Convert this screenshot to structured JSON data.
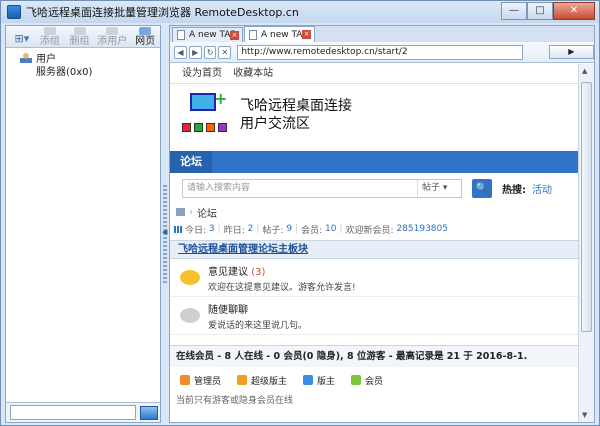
{
  "window": {
    "title": "飞哈远程桌面连接批量管理浏览器 RemoteDesktop.cn",
    "minimize": "—",
    "maximize": "□",
    "close": "✕"
  },
  "left_toolbar": {
    "items": [
      "添组",
      "删组",
      "添用户",
      "网页"
    ]
  },
  "tree": {
    "items": [
      "用户",
      "服务器(0x0)"
    ]
  },
  "tabs": [
    {
      "label": "A new TAB",
      "close": "×"
    },
    {
      "label": "A new TAB",
      "close": "×"
    }
  ],
  "address": {
    "url": "http://www.remotedesktop.cn/start/2",
    "go": "▶"
  },
  "site": {
    "top_links": [
      "设为首页",
      "收藏本站"
    ],
    "logo_line1": "飞哈远程桌面连接",
    "logo_line2": "用户交流区",
    "nav_item": "论坛",
    "search_placeholder": "请输入搜索内容",
    "search_scope": "帖子 ▾",
    "search_button": "🔍",
    "hot_label": "热搜:",
    "hot_link": "活动",
    "breadcrumb": "论坛",
    "stats": {
      "today_label": "今日:",
      "today": "3",
      "yesterday_label": "昨日:",
      "yesterday": "2",
      "posts_label": "帖子:",
      "posts": "9",
      "members_label": "会员:",
      "members": "10",
      "newest_label": "欢迎新会员:",
      "newest": "285193805"
    },
    "section_title": "飞哈远程桌面管理论坛主板块",
    "forums": [
      {
        "title": "意见建议",
        "count": "(3)",
        "desc": "欢迎在这提意见建议。游客允许发言!"
      },
      {
        "title": "随便聊聊",
        "count": "",
        "desc": "爱说话的来这里说几句。"
      }
    ],
    "online_text": "在线会员 - 8 人在线 - 0 会员(0 隐身), 8 位游客 - 最高记录是  21  于  2016-8-1.",
    "legend": [
      {
        "label": "管理员",
        "color": "#f08a2a"
      },
      {
        "label": "超级版主",
        "color": "#f0a020"
      },
      {
        "label": "版主",
        "color": "#3a8ee0"
      },
      {
        "label": "会员",
        "color": "#7cc43a"
      }
    ],
    "tail_text": "当前只有游客或隐身会员在线"
  }
}
